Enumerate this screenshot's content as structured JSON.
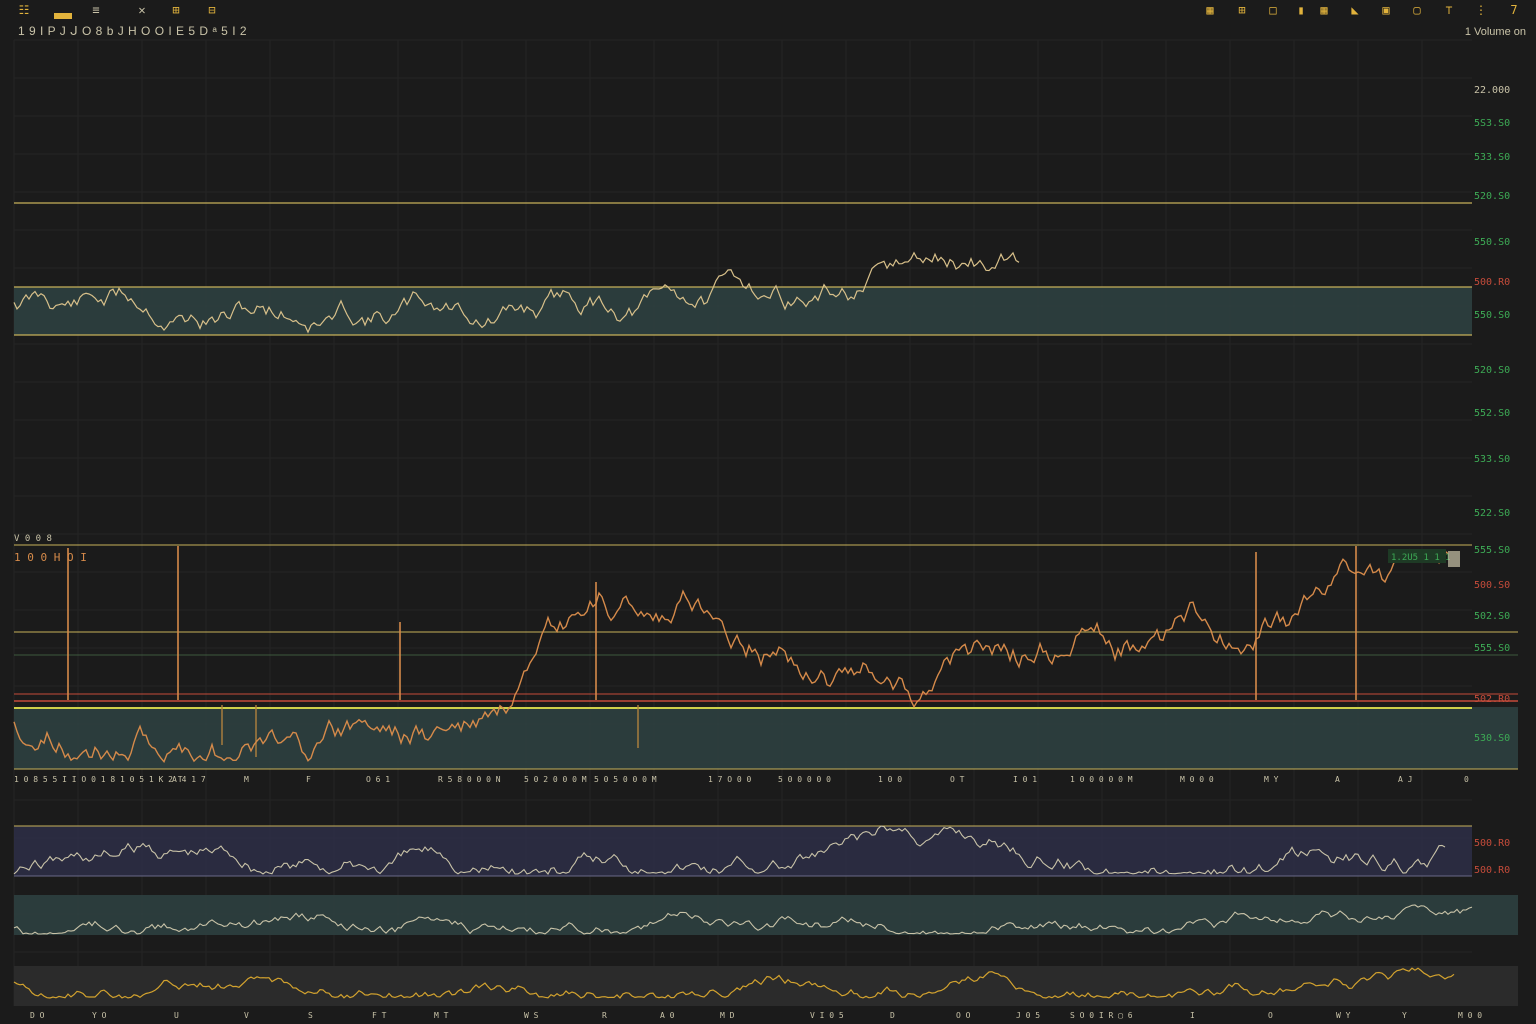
{
  "toolbar": {
    "left": [
      {
        "icon": "grid-icon",
        "label": "☷"
      },
      {
        "icon": "bar-icon",
        "label": ""
      },
      {
        "icon": "lines-icon",
        "label": "≡"
      },
      {
        "icon": "draw-icon",
        "label": "✕"
      },
      {
        "icon": "indicator-icon",
        "label": "⊞"
      },
      {
        "icon": "layout-icon",
        "label": "⊟"
      }
    ],
    "right": [
      {
        "icon": "grid-icon",
        "label": "▦"
      },
      {
        "icon": "table-icon",
        "label": "⊞"
      },
      {
        "icon": "window-icon",
        "label": "□"
      },
      {
        "icon": "pill-icon",
        "label": "▮"
      },
      {
        "icon": "grid-small-icon",
        "label": "▦"
      },
      {
        "icon": "bookmark-icon",
        "label": "◣"
      },
      {
        "icon": "square-icon",
        "label": "▣"
      },
      {
        "icon": "frame-icon",
        "label": "▢"
      },
      {
        "icon": "minus-icon",
        "label": "⊤"
      },
      {
        "icon": "settings-icon",
        "label": "⋮"
      },
      {
        "icon": "seven-icon",
        "label": "7"
      }
    ]
  },
  "header": {
    "title": "1 9 I P J  ᒍ O 8 b  J H O  O I E 5 D  ᵃ 5 I 2",
    "right_text": "1  Volume on"
  },
  "colors": {
    "background": "#1b1b1b",
    "gold": "#c7b15a",
    "line": "#d8c08a",
    "fill": "#2d4040",
    "green": "#3daa55",
    "red": "#c44b3a",
    "orange": "#d58a4a",
    "purple": "#2e2f4a"
  },
  "price_axis": {
    "labels": [
      {
        "text": "22.000",
        "color": "pale"
      },
      {
        "text": "5S3.S0",
        "color": "green"
      },
      {
        "text": "533.S0",
        "color": "green"
      },
      {
        "text": "520.S0",
        "color": "green"
      },
      {
        "text": "550.S0",
        "color": "green"
      },
      {
        "text": "500.R0",
        "color": "red"
      },
      {
        "text": "550.S0",
        "color": "green"
      },
      {
        "text": "520.S0",
        "color": "green"
      },
      {
        "text": "552.S0",
        "color": "green"
      },
      {
        "text": "533.S0",
        "color": "green"
      },
      {
        "text": "522.S0",
        "color": "green"
      },
      {
        "text": "555.S0",
        "color": "green"
      },
      {
        "text": "500.S0",
        "color": "red"
      },
      {
        "text": "502.S0",
        "color": "green"
      },
      {
        "text": "555.S0",
        "color": "green"
      },
      {
        "text": "502.R0",
        "color": "red"
      },
      {
        "text": "530.S0",
        "color": "green"
      },
      {
        "text": "500.R0",
        "color": "red"
      },
      {
        "text": "500.R0",
        "color": "red"
      }
    ]
  },
  "panes": {
    "main": {
      "label": "V 0 0 8"
    },
    "volume": {
      "label": "1 0 0 H O I",
      "tag": "1.2U5  1 1 1"
    }
  },
  "mid_dates": [
    "1 0 8 5 5 I I   O 0 1 8   1 0 5 1 K 2 T",
    "A 4 1 7",
    "M",
    "F",
    "O 6 1",
    "R 5 8 0 0 0 N",
    "5 0 2 0 0 0 M",
    "5 0 5 0 0 0 M",
    "1 7 O 0 0",
    "5 0 0 0 0 0",
    "1 0 0",
    "O T",
    "I 0 1",
    "1 0 0 0 0 0 M",
    "M 0 0 0",
    "M Y",
    "A",
    "A J",
    "0"
  ],
  "bottom_dates": [
    "D O",
    "Y O",
    "U",
    "V",
    "S",
    "F T",
    "M T",
    "W S",
    "R",
    "A 0",
    "M D",
    "V I 0 5",
    "D",
    "O O",
    "J 0 5",
    "S O 0 I R  ▢ 6",
    "I",
    "O",
    "W Y",
    "Y",
    "M 0 0"
  ],
  "chart_data": {
    "type": "line",
    "panes": [
      {
        "name": "price",
        "band": "shaded range"
      },
      {
        "name": "volume"
      },
      {
        "name": "oscillator 1"
      },
      {
        "name": "oscillator 2"
      },
      {
        "name": "oscillator 3"
      }
    ]
  }
}
